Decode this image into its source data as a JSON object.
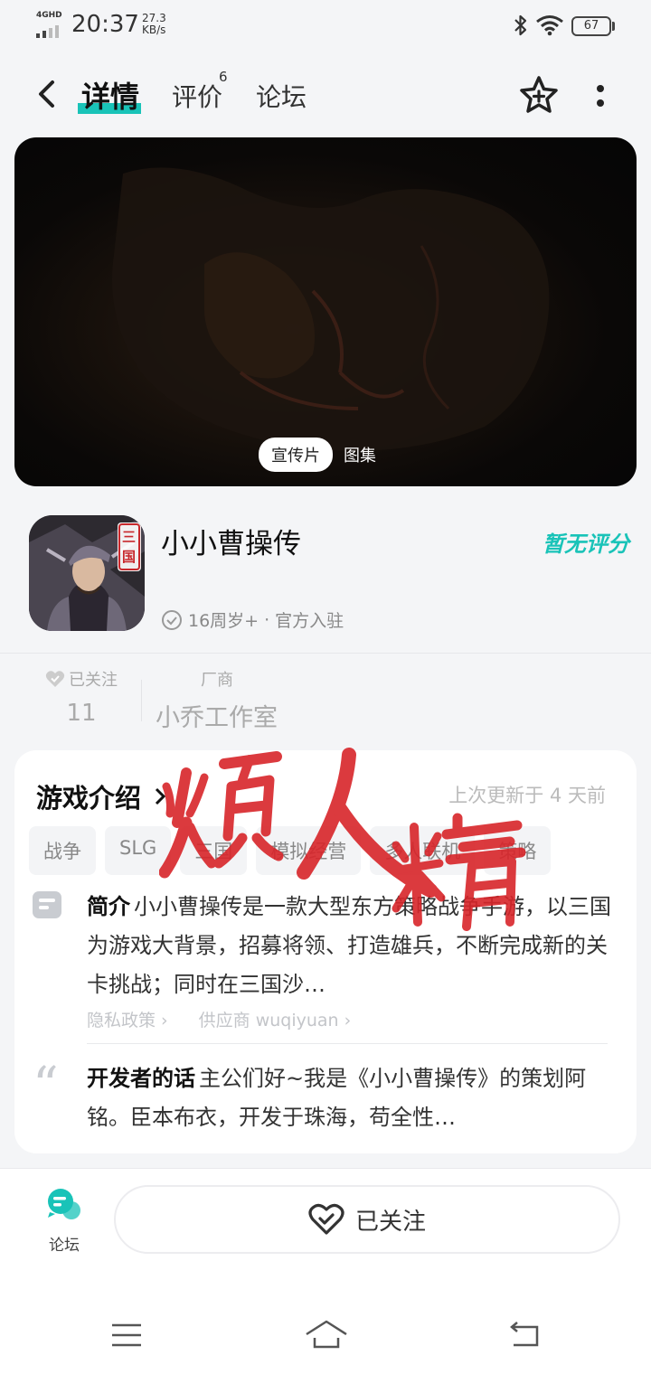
{
  "status_bar": {
    "network": "4GHD",
    "time": "20:37",
    "speed_value": "27.3",
    "speed_unit": "KB/s",
    "battery": "67",
    "icons": [
      "signal-icon",
      "bluetooth-icon",
      "wifi-icon",
      "battery-icon"
    ]
  },
  "header": {
    "tabs": [
      {
        "label": "详情",
        "active": true
      },
      {
        "label": "评价",
        "badge": "6"
      },
      {
        "label": "论坛"
      }
    ],
    "icons": [
      "back-icon",
      "star-plus-icon",
      "more-vertical-icon"
    ]
  },
  "media": {
    "tabs": [
      {
        "label": "宣传片",
        "active": true
      },
      {
        "label": "图集"
      }
    ]
  },
  "app": {
    "name": "小小曹操传",
    "rating": "暂无评分",
    "age": "16周岁+",
    "official": "官方入驻",
    "icon_badge": "三国"
  },
  "stats": {
    "follow_label": "已关注",
    "follow_count": "11",
    "vendor_label": "厂商",
    "vendor_name": "小乔工作室"
  },
  "intro": {
    "title": "游戏介绍",
    "updated": "上次更新于 4 天前",
    "tags": [
      "战争",
      "SLG",
      "三国",
      "模拟经营",
      "多人联机",
      "策略"
    ],
    "summary_label": "简介",
    "summary_text": "小小曹操传是一款大型东方策略战争手游，以三国为游戏大背景，招募将领、打造雄兵，不断完成新的关卡挑战；同时在三国沙…",
    "privacy": "隐私政策",
    "supplier": "供应商 wuqiyuan",
    "dev_label": "开发者的话",
    "dev_text": "主公们好~我是《小小曹操传》的策划阿铭。臣本布衣，开发于珠海，苟全性…"
  },
  "watermark": "烦人精",
  "bottom": {
    "forum_label": "论坛",
    "follow_button": "已关注"
  },
  "colors": {
    "accent": "#19c3b8",
    "watermark": "#d8252a"
  }
}
